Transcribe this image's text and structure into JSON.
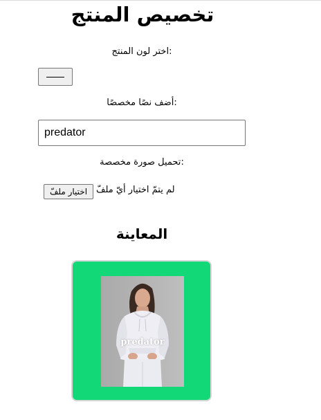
{
  "page": {
    "title": "تخصيص المنتج",
    "color_label": "اختر لون المنتج:",
    "text_label": "أضف نصًا مخصصًا:",
    "text_value": "predator",
    "image_label": "تحميل صورة مخصصة:",
    "file_button_label": "اختيار ملفّ",
    "file_status": "لم يتمّ اختيار أيّ ملفّ",
    "preview_title": "المعاينة",
    "preview_overlay_text": "predator"
  },
  "colors": {
    "product_color": "#13d878",
    "selected_color_swatch": "#000000"
  },
  "icons": {
    "color_swatch": "color-swatch-icon"
  }
}
